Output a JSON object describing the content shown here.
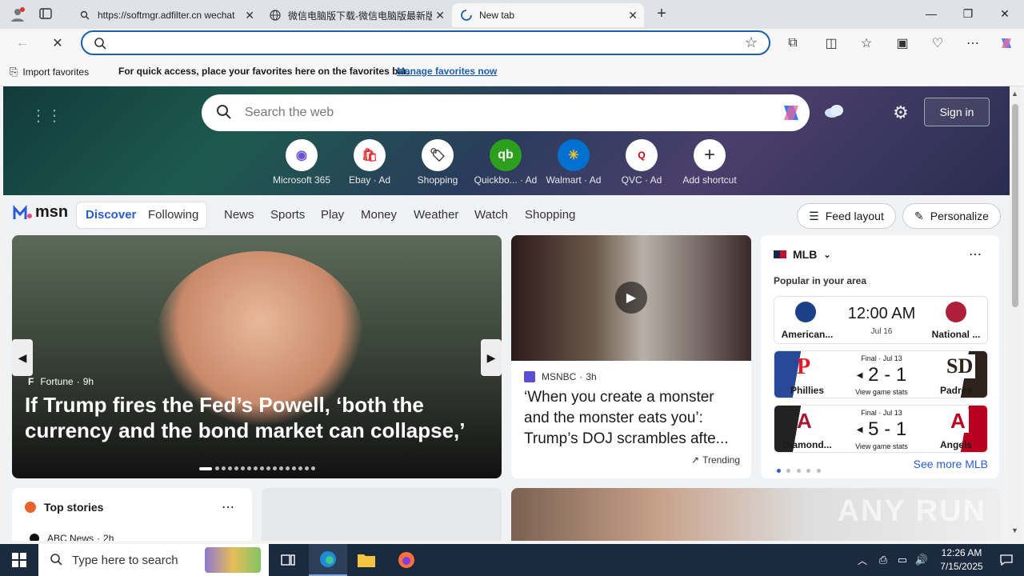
{
  "browser": {
    "tabs": [
      {
        "title": "https://softmgr.adfilter.cn wechat",
        "icon": "search-icon"
      },
      {
        "title": "微信电脑版下载-微信电脑版最新版",
        "icon": "globe-icon"
      },
      {
        "title": "New tab",
        "icon": "loading-icon"
      }
    ],
    "address_value": "",
    "favorites_bar": {
      "import_label": "Import favorites",
      "message": "For quick access, place your favorites here on the favorites bar.",
      "manage_link": "Manage favorites now"
    }
  },
  "hero": {
    "search_placeholder": "Search the web",
    "sign_in": "Sign in",
    "quick_links": [
      {
        "label": "Microsoft 365",
        "icon": "m365-icon"
      },
      {
        "label": "Ebay · Ad",
        "icon": "ebay-icon"
      },
      {
        "label": "Shopping",
        "icon": "shopping-tag-icon"
      },
      {
        "label": "Quickbo... · Ad",
        "icon": "quickbooks-icon"
      },
      {
        "label": "Walmart · Ad",
        "icon": "walmart-icon"
      },
      {
        "label": "QVC · Ad",
        "icon": "qvc-icon"
      },
      {
        "label": "Add shortcut",
        "icon": "plus-icon"
      }
    ]
  },
  "msn_nav": {
    "logo": "msn",
    "tabs": [
      "Discover",
      "Following"
    ],
    "items": [
      "News",
      "Sports",
      "Play",
      "Money",
      "Weather",
      "Watch",
      "Shopping"
    ],
    "feed_layout": "Feed layout",
    "personalize": "Personalize"
  },
  "carousel": {
    "source": "Fortune",
    "age": "9h",
    "headline": "If Trump fires the Fed’s Powell, ‘both the currency and the bond market can collapse,’ according to..."
  },
  "video_card": {
    "source": "MSNBC",
    "age": "3h",
    "headline": "‘When you create a monster and the monster eats you’: Trump’s DOJ scrambles afte...",
    "trending": "Trending"
  },
  "mlb": {
    "title": "MLB",
    "subtitle": "Popular in your area",
    "games": [
      {
        "home": "American...",
        "away": "National ...",
        "status": "",
        "time": "12:00 AM",
        "date": "Jul 16",
        "score": ""
      },
      {
        "home": "Phillies",
        "away": "Padres",
        "status": "Final · Jul 13",
        "score_left": "2",
        "score_right": "1",
        "link": "View game stats"
      },
      {
        "home": "Diamond...",
        "away": "Angels",
        "status": "Final · Jul 13",
        "score_left": "5",
        "score_right": "1",
        "link": "View game stats"
      }
    ],
    "see_more": "See more MLB"
  },
  "top_stories": {
    "title": "Top stories",
    "first_source": "ABC News",
    "first_age": "2h"
  },
  "taskbar": {
    "search_placeholder": "Type here to search",
    "time": "12:26 AM",
    "date": "7/15/2025"
  },
  "watermark": "ANY RUN"
}
